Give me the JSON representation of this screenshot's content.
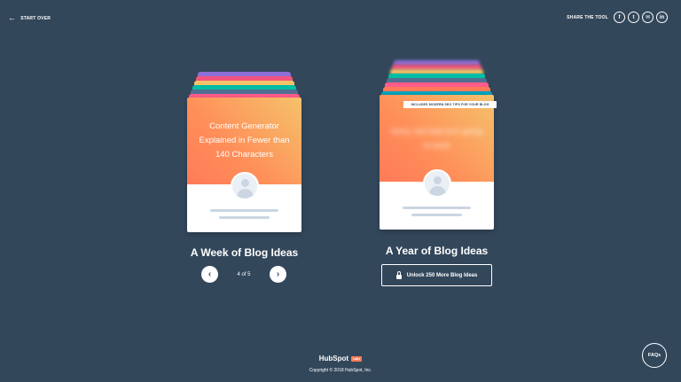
{
  "header": {
    "start_over_label": "START OVER",
    "share_label": "SHARE THE TOOL",
    "social": [
      {
        "name": "facebook",
        "glyph": "f"
      },
      {
        "name": "twitter",
        "glyph": "t"
      },
      {
        "name": "email",
        "glyph": "✉"
      },
      {
        "name": "linkedin",
        "glyph": "in"
      }
    ]
  },
  "left_card": {
    "text": "Content Generator Explained in Fewer than 140 Characters",
    "heading": "A Week of Blog Ideas",
    "pager": {
      "count": "4 of 5",
      "prev_glyph": "‹",
      "next_glyph": "›"
    },
    "stack_colors": [
      "#8e6fd8",
      "#f2547d",
      "#f5c26b",
      "#00bda5",
      "#516f90",
      "#ff5c8a"
    ]
  },
  "right_card": {
    "text": "Sorry, but that isn't going to work",
    "heading": "A Year of Blog Ideas",
    "seo_tag": "INCLUDES MODERN SEO TIPS FOR YOUR BLOG",
    "unlock_label": "Unlock 250 More Blog Ideas",
    "stack_colors": [
      "#8e6fd8",
      "#f2547d",
      "#f5c26b",
      "#00bda5",
      "#516f90",
      "#ff5c8a",
      "#ff7a59",
      "#00a4bd"
    ]
  },
  "footer": {
    "logo": "HubSpot",
    "logo_badge": "Labs",
    "copyright": "Copyright © 2018 HubSpot, Inc."
  },
  "faqs_label": "FAQs"
}
